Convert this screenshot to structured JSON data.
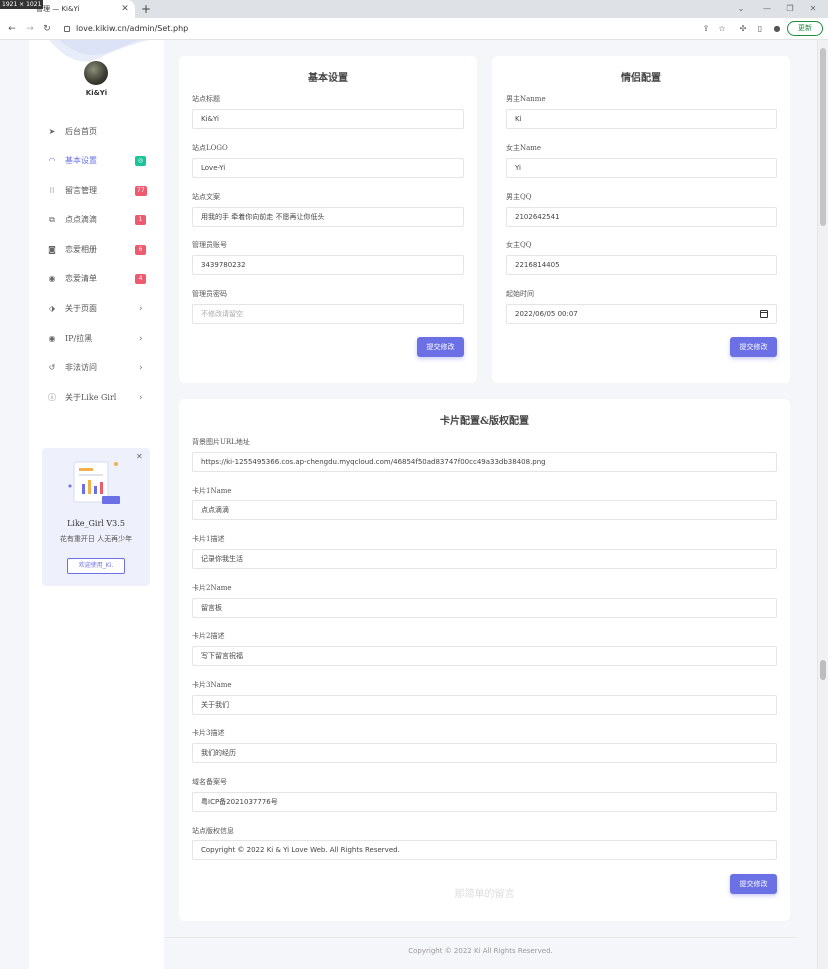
{
  "browser": {
    "dim_badge": "1921 × 1021",
    "tab_title": "管理 — Ki&Yi",
    "url": "love.kikiw.cn/admin/Set.php",
    "update_label": "更新",
    "new_tab_icon": "plus-icon",
    "close_icon": "close-icon"
  },
  "sidebar": {
    "user_name": "Ki&Yi",
    "items": [
      {
        "label": "后台首页",
        "icon": "send-icon",
        "badge": null,
        "arrow": false
      },
      {
        "label": "基本设置",
        "icon": "gauge-icon",
        "badge": "◎",
        "badge_color": "#1bc59c",
        "arrow": false,
        "active": true
      },
      {
        "label": "留言管理",
        "icon": "grid-icon",
        "badge": "77",
        "badge_color": "#ef5a6f",
        "arrow": false
      },
      {
        "label": "点点滴滴",
        "icon": "copy-icon",
        "badge": "1",
        "badge_color": "#ef5a6f",
        "arrow": false
      },
      {
        "label": "恋爱相册",
        "icon": "camera-icon",
        "badge": "6",
        "badge_color": "#ef5a6f",
        "arrow": false
      },
      {
        "label": "恋爱清单",
        "icon": "pin-icon",
        "badge": "4",
        "badge_color": "#ef5a6f",
        "arrow": false
      },
      {
        "label": "关于页面",
        "icon": "tag-icon",
        "badge": null,
        "arrow": true
      },
      {
        "label": "IP/拉黑",
        "icon": "location-icon",
        "badge": null,
        "arrow": true
      },
      {
        "label": "非法访问",
        "icon": "history-icon",
        "badge": null,
        "arrow": true
      },
      {
        "label": "关于Like Girl",
        "icon": "info-icon",
        "badge": null,
        "arrow": true
      }
    ],
    "promo": {
      "title": "Like_Girl V3.5",
      "subtitle": "花有重开日 人无再少年",
      "button_label": "欢迎使用_Ki."
    }
  },
  "basic_settings": {
    "title": "基本设置",
    "fields": [
      {
        "label": "站点标题",
        "value": "Ki&Yi",
        "placeholder": ""
      },
      {
        "label": "站点LOGO",
        "value": "Love-Yi",
        "placeholder": ""
      },
      {
        "label": "站点文案",
        "value": "用我的手 牵着你向前走 不愿再让你低头",
        "placeholder": ""
      },
      {
        "label": "管理员账号",
        "value": "3439780232",
        "placeholder": ""
      },
      {
        "label": "管理员密码",
        "value": "",
        "placeholder": "不修改请留空"
      }
    ],
    "submit_label": "提交修改"
  },
  "couple_settings": {
    "title": "情侣配置",
    "fields": [
      {
        "label": "男主Nanme",
        "value": "Ki"
      },
      {
        "label": "女主Name",
        "value": "Yi"
      },
      {
        "label": "男主QQ",
        "value": "2102642541"
      },
      {
        "label": "女主QQ",
        "value": "2216814405"
      },
      {
        "label": "起始时间",
        "value": "2022/06/05 00:07"
      }
    ],
    "submit_label": "提交修改"
  },
  "card_settings": {
    "title": "卡片配置&版权配置",
    "fields": [
      {
        "label": "背景图片URL地址",
        "value": "https://ki-1255495366.cos.ap-chengdu.myqcloud.com/46854f50ad83747f00cc49a33db38408.png"
      },
      {
        "label": "卡片1Name",
        "value": "点点滴滴"
      },
      {
        "label": "卡片1描述",
        "value": "记录你我生活"
      },
      {
        "label": "卡片2Name",
        "value": "留言板"
      },
      {
        "label": "卡片2描述",
        "value": "写下留言祝福"
      },
      {
        "label": "卡片3Name",
        "value": "关于我们"
      },
      {
        "label": "卡片3描述",
        "value": "我们的经历"
      },
      {
        "label": "域名备案号",
        "value": "粤ICP备2021037776号"
      },
      {
        "label": "站点版权信息",
        "value": "Copyright © 2022 Ki & Yi Love Web. All Rights Reserved."
      }
    ],
    "submit_label": "提交修改",
    "watermark": "那简单的留言"
  },
  "footer": {
    "copyright": "Copyright © 2022 Ki All Rights Reserved."
  },
  "colors": {
    "accent": "#6b70e5",
    "badge_red": "#ef5a6f",
    "badge_green": "#1bc59c"
  }
}
